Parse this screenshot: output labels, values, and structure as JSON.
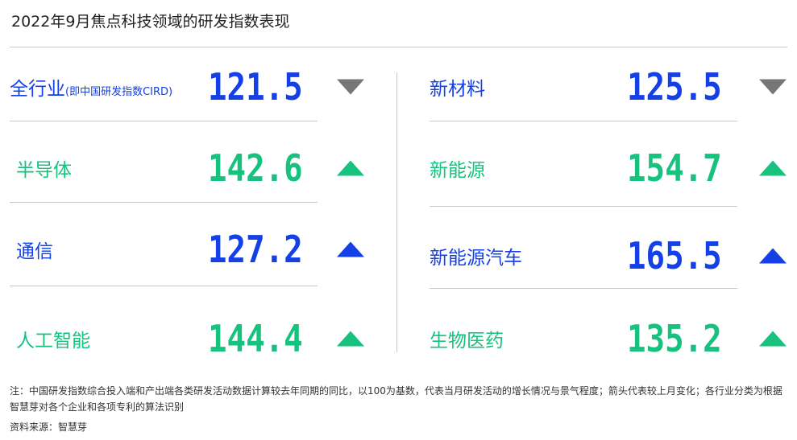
{
  "title": "2022年9月焦点科技领域的研发指数表现",
  "colors": {
    "blue": "#1440e6",
    "green": "#17c27e",
    "gray_arrow": "#777777"
  },
  "left": [
    {
      "label": "全行业",
      "sub": "(即中国研发指数CIRD)",
      "value": "121.5",
      "arrow": "down",
      "color": "blue"
    },
    {
      "label": "半导体",
      "value": "142.6",
      "arrow": "up",
      "color": "green"
    },
    {
      "label": "通信",
      "value": "127.2",
      "arrow": "up",
      "color": "blue"
    },
    {
      "label": "人工智能",
      "value": "144.4",
      "arrow": "up",
      "color": "green"
    }
  ],
  "right": [
    {
      "label": "新材料",
      "value": "125.5",
      "arrow": "down",
      "color": "blue"
    },
    {
      "label": "新能源",
      "value": "154.7",
      "arrow": "up",
      "color": "green"
    },
    {
      "label": "新能源汽车",
      "value": "165.5",
      "arrow": "up",
      "color": "blue"
    },
    {
      "label": "生物医药",
      "value": "135.2",
      "arrow": "up",
      "color": "green"
    }
  ],
  "note": "注：中国研发指数综合投入端和产出端各类研发活动数据计算较去年同期的同比，以100为基数，代表当月研发活动的增长情况与景气程度；箭头代表较上月变化；各行业分类为根据智慧芽对各个企业和各项专利的算法识别",
  "source": "资料来源：智慧芽"
}
